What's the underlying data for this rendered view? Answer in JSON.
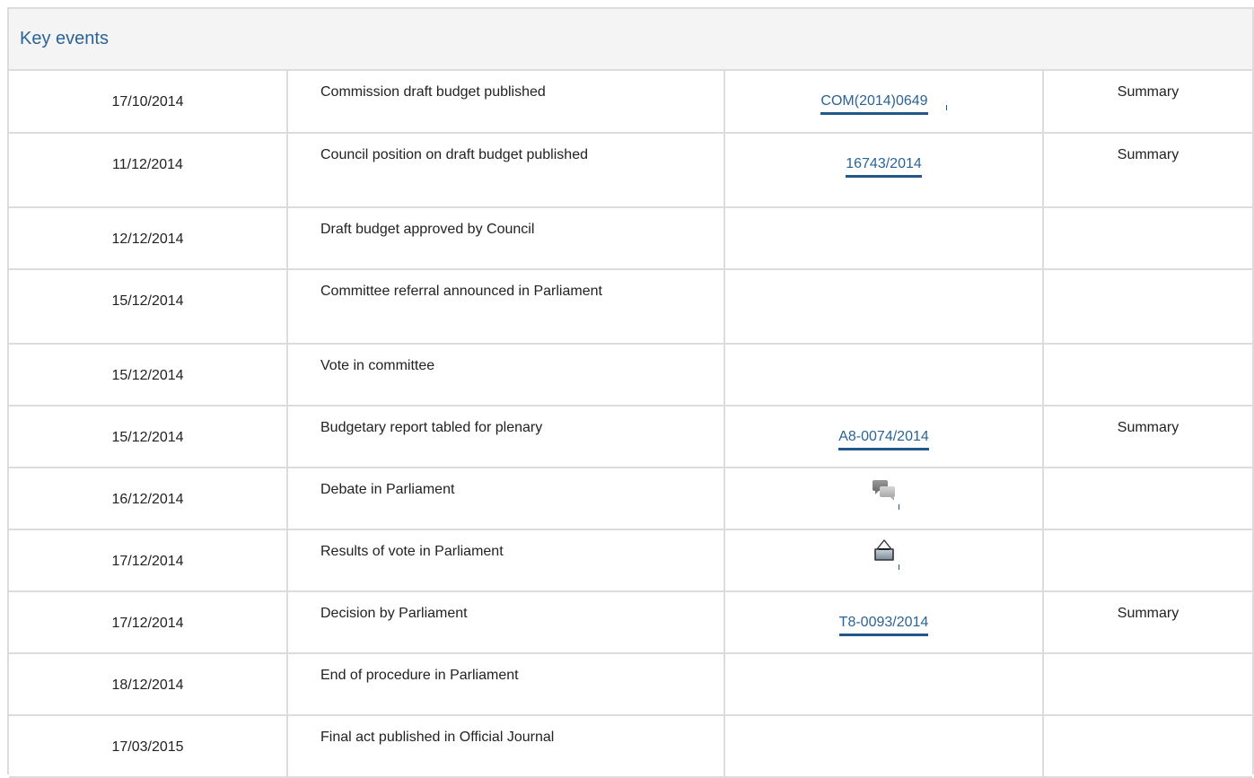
{
  "section": {
    "title": "Key events"
  },
  "events": [
    {
      "date": "17/10/2014",
      "event": "Commission draft budget published",
      "document": "COM(2014)0649",
      "summary": "Summary"
    },
    {
      "date": "11/12/2014",
      "event": "Council position on draft budget published",
      "document": "16743/2014",
      "summary": "Summary"
    },
    {
      "date": "12/12/2014",
      "event": "Draft budget approved by Council",
      "document": "",
      "summary": ""
    },
    {
      "date": "15/12/2014",
      "event": "Committee referral announced in Parliament",
      "document": "",
      "summary": ""
    },
    {
      "date": "15/12/2014",
      "event": "Vote in committee",
      "document": "",
      "summary": ""
    },
    {
      "date": "15/12/2014",
      "event": "Budgetary report tabled for plenary",
      "document": "A8-0074/2014",
      "summary": "Summary"
    },
    {
      "date": "16/12/2014",
      "event": "Debate in Parliament",
      "icon": "debate-icon",
      "summary": ""
    },
    {
      "date": "17/12/2014",
      "event": "Results of vote in Parliament",
      "icon": "vote-results-icon",
      "summary": ""
    },
    {
      "date": "17/12/2014",
      "event": "Decision by Parliament",
      "document": "T8-0093/2014",
      "summary": "Summary"
    },
    {
      "date": "18/12/2014",
      "event": "End of procedure in Parliament",
      "document": "",
      "summary": ""
    },
    {
      "date": "17/03/2015",
      "event": "Final act published in Official Journal",
      "document": "",
      "summary": ""
    }
  ],
  "colors": {
    "link": "#2a6496",
    "link_underline": "#22578a",
    "border": "#dcdcdc",
    "header_bg": "#f4f4f4"
  }
}
